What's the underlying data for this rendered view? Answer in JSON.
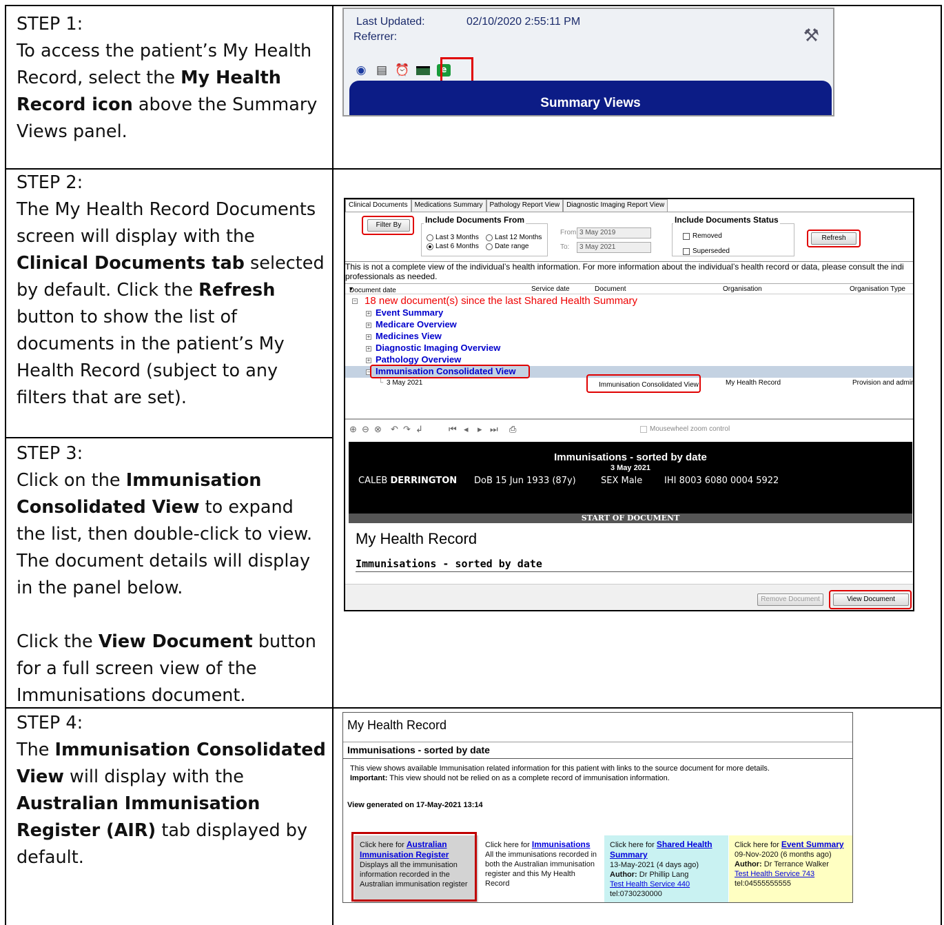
{
  "steps": {
    "step1": {
      "heading": "STEP 1:",
      "t1": "To access the patient’s My Health Record, select the ",
      "b1": "My Health Record icon",
      "t2": " above the Summary Views panel."
    },
    "step2": {
      "heading": "STEP 2:",
      "t1": "The My Health Record Documents screen will display with the ",
      "b1": "Clinical Documents tab",
      "t2": " selected by default. Click the ",
      "b2": "Refresh",
      "t3": " button to show the list of documents in the patient’s My Health Record (subject to any filters that are set)."
    },
    "step3": {
      "heading": "STEP 3:",
      "t1": "Click on the ",
      "b1": "Immunisation Consolidated View",
      "t2": " to expand the list, then double-click to view. The document details will display in the panel below.",
      "t3": "Click the ",
      "b2": "View Document",
      "t4": " button for a full screen view of the Immunisations document."
    },
    "step4": {
      "heading": "STEP 4:",
      "t1": "The ",
      "b1": "Immunisation Consolidated View",
      "t2": " will display with the ",
      "b2": "Australian Immunisation Register (AIR)",
      "t3": " tab displayed by default."
    }
  },
  "shot1": {
    "last_updated_label": "Last Updated:",
    "last_updated_value": "02/10/2020 2:55:11 PM",
    "referrer_label": "Referrer:",
    "panel_title": "Summary Views",
    "icons": [
      "eye-icon",
      "document-icon",
      "alarm-icon",
      "card-icon",
      "my-health-record-icon"
    ]
  },
  "shot2": {
    "tabs": [
      "Clinical Documents",
      "Medications Summary",
      "Pathology Report View",
      "Diagnostic Imaging Report View"
    ],
    "filter_by": "Filter By",
    "include_from_title": "Include Documents From",
    "radio_last3": "Last 3 Months",
    "radio_last12": "Last 12 Months",
    "radio_last6": "Last 6 Months",
    "radio_range": "Date range",
    "from_label": "From:",
    "from_value": "3 May 2019",
    "to_label": "To:",
    "to_value": "3 May 2021",
    "status_title": "Include Documents Status",
    "removed": "Removed",
    "superseded": "Superseded",
    "refresh": "Refresh",
    "notice": "This is not a complete view of the individual’s health information. For more information about the individual’s health record or data, please consult the indi",
    "notice2": "professionals as needed.",
    "col_docdate": "Document date",
    "col_service": "Service date",
    "col_document": "Document",
    "col_org": "Organisation",
    "col_orgtype": "Organisation Type",
    "head_row": "18 new document(s) since the last Shared Health Summary",
    "items": [
      "Event Summary",
      "Medicare Overview",
      "Medicines View",
      "Diagnostic Imaging Overview",
      "Pathology Overview",
      "Immunisation Consolidated View"
    ],
    "child_date": "3 May 2021",
    "child_document": "Immunisation Consolidated View",
    "child_org": "My Health Record",
    "child_orgtype": "Provision and admir",
    "mousewheel": "Mousewheel zoom control",
    "doc_title": "Immunisations - sorted by date",
    "doc_date": "3 May 2021",
    "patient_first": "CALEB ",
    "patient_last": "DERRINGTON",
    "dob": "DoB 15 Jun 1933 (87y)",
    "sex": "SEX Male",
    "ihi": "IHI 8003 6080 0004 5922",
    "start_doc": "START OF DOCUMENT",
    "mhr_heading": "My Health Record",
    "mhr_sub": "Immunisations - sorted by date",
    "remove_doc": "Remove Document",
    "view_doc": "View Document"
  },
  "shot4": {
    "title": "My Health Record",
    "subtitle": "Immunisations - sorted by date",
    "info1": "This view shows available Immunisation related information for this patient with links to the source document for more details.",
    "important_label": "Important:",
    "info2": " This view should not be relied on as a complete record of immunisation information.",
    "generated": "View generated on 17-May-2021 13:14",
    "click_here_for": "Click here for ",
    "card1": {
      "link": "Australian Immunisation Register",
      "desc": "Displays all the immunisation information recorded in the Australian immunisation register",
      "bg": "#d3d3d3"
    },
    "card2": {
      "link": "Immunisations",
      "desc": "All the immunisations recorded in both the Australian immunisation register and this My Health Record",
      "bg": "#ffffff"
    },
    "card3": {
      "link": "Shared Health Summary",
      "date": "13-May-2021 (4 days ago)",
      "author_label": "Author:",
      "author": " Dr Phillip Lang",
      "org": "Test Health Service 440",
      "tel": "tel:0730230000",
      "bg": "#c9f2f2"
    },
    "card4": {
      "link": "Event Summary",
      "date": "09-Nov-2020 (6 months ago)",
      "author_label": "Author:",
      "author": " Dr Terrance Walker",
      "org": "Test Health Service 743",
      "tel": "tel:04555555555",
      "bg": "#ffffc2"
    }
  },
  "colors": {
    "highlight_red": "#e00000",
    "panel_blue": "#0c1c86",
    "link_blue": "#0000dd"
  }
}
